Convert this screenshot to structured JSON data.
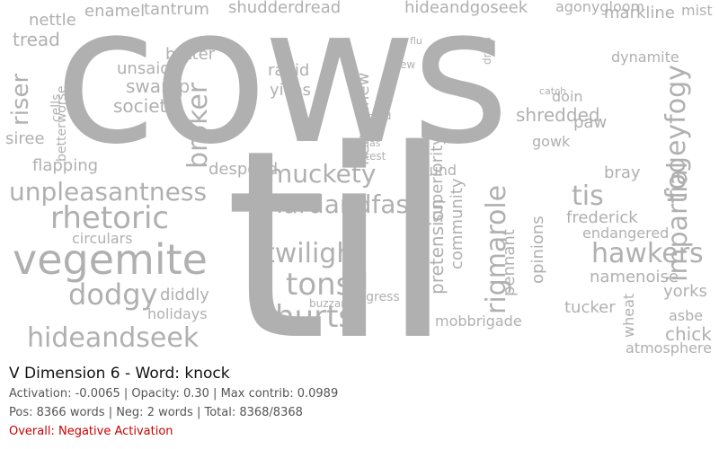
{
  "wordcloud": {
    "color": "#b0b0b0",
    "words": [
      "cows",
      "til",
      "vegemite",
      "unpleasantness",
      "hideandseek",
      "hardandfast",
      "twilight",
      "tonsil",
      "hurts",
      "rhetoric",
      "dodgy",
      "muckety",
      "broker",
      "fogeyfogy",
      "impartial",
      "hawkers",
      "rigmarole",
      "tis",
      "society",
      "swamp",
      "riser",
      "tread",
      "nettle",
      "enamel",
      "tantrum",
      "shudderdread",
      "hideandgoseek",
      "agonygloom",
      "markline",
      "mist",
      "shredded",
      "paw",
      "gowk",
      "bray",
      "frederick",
      "endangered",
      "namenoise",
      "yorks",
      "chick",
      "atmosphere",
      "tucker",
      "asbe",
      "mobbrigade",
      "pretension",
      "superiority",
      "community",
      "opinions",
      "pennant",
      "nervesinew",
      "rapid",
      "yikes",
      "batter",
      "unsaid",
      "despond",
      "flapping",
      "circulars",
      "holidays",
      "diddly",
      "siree",
      "betterworse",
      "cells",
      "dynamite",
      "doin",
      "fund",
      "wheat",
      "description",
      "congress",
      "buzzard",
      "fittest",
      "kicked",
      "judas",
      "anew",
      "flu",
      "dried",
      "catch"
    ]
  },
  "caption": {
    "title": "V Dimension 6 - Word: knock",
    "stats_line": "Activation: -0.0065 | Opacity: 0.30 | Max contrib: 0.0989",
    "counts_line": "Pos: 8366 words | Neg: 2 words | Total: 8368/8368",
    "overall": "Overall: Negative Activation",
    "overall_color": "#cc0000"
  }
}
